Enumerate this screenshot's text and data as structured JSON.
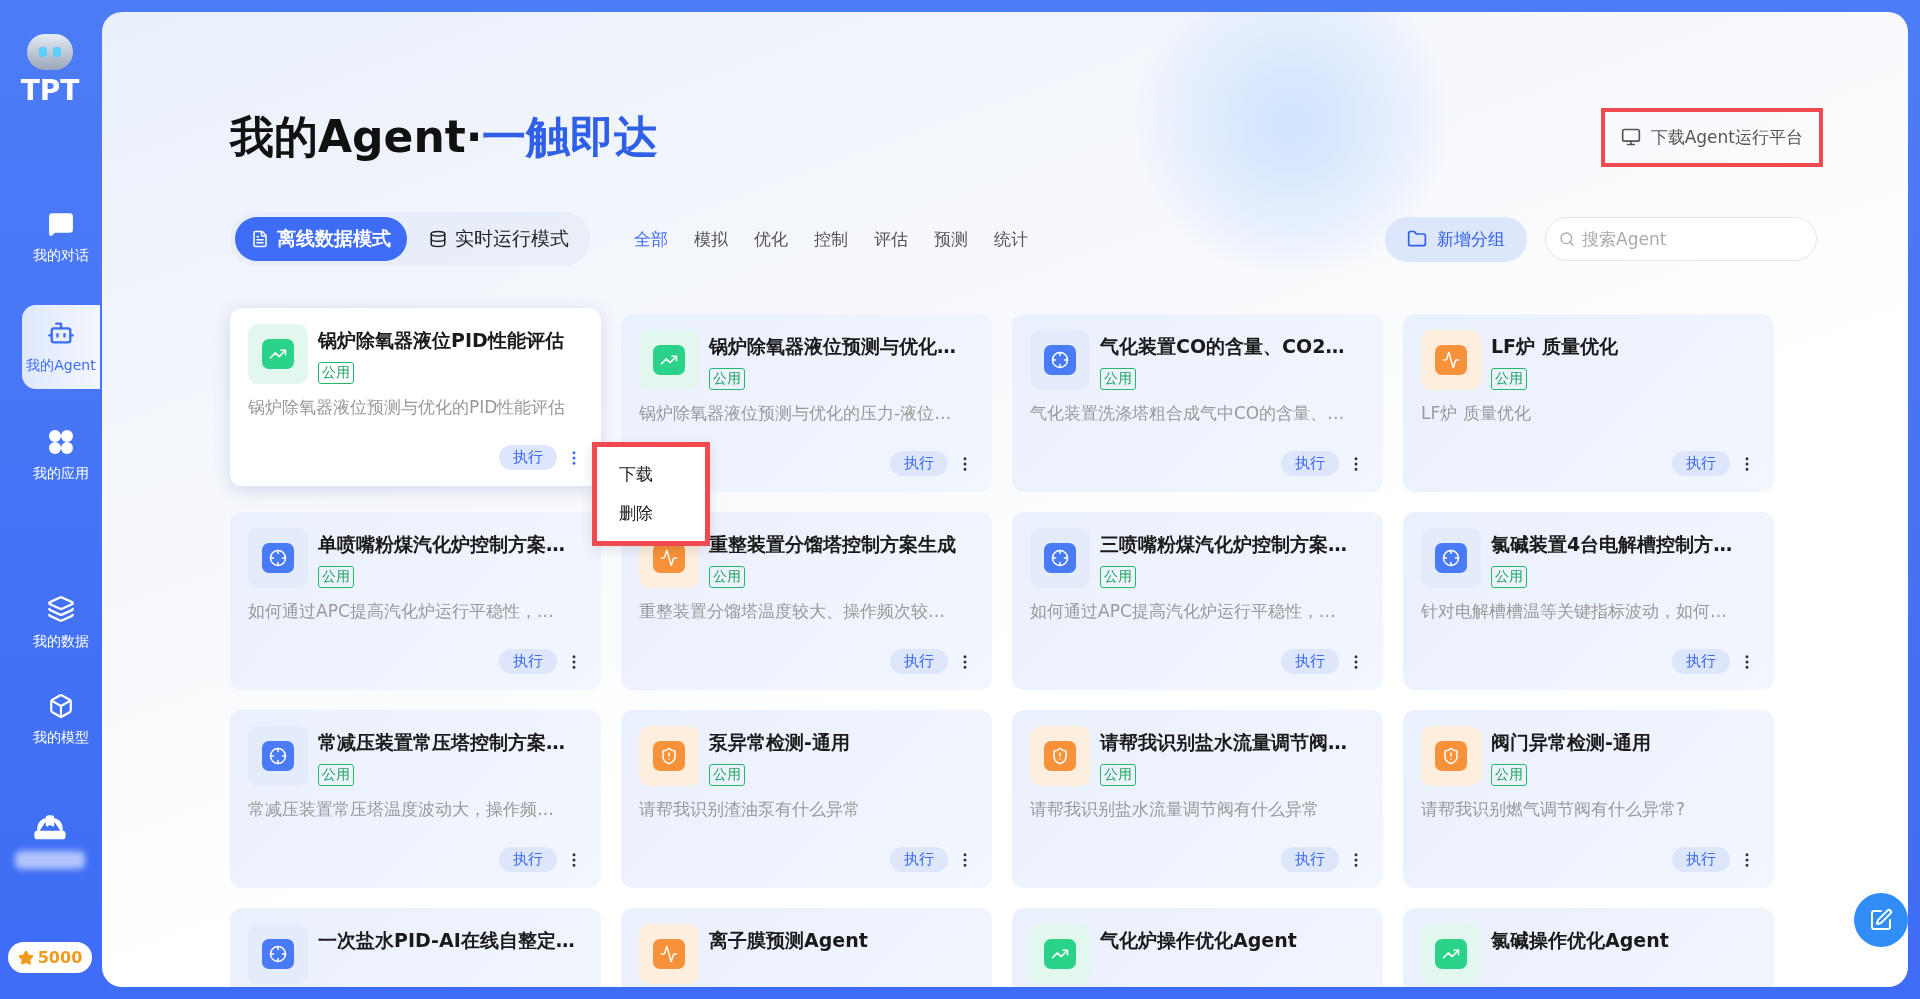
{
  "sidebar": {
    "logo": "TPT",
    "items": [
      {
        "kind": "chat",
        "label": "我的对话",
        "selected": false
      },
      {
        "kind": "agent",
        "label": "我的Agent",
        "selected": true
      },
      {
        "kind": "apps",
        "label": "我的应用",
        "selected": false
      },
      {
        "kind": "data",
        "label": "我的数据",
        "selected": false
      },
      {
        "kind": "model",
        "label": "我的模型",
        "selected": false
      }
    ],
    "coins": "5000"
  },
  "header": {
    "title": "我的Agent·",
    "title_accent": "一触即达",
    "download_button": "下载Agent运行平台"
  },
  "modes": [
    {
      "label": "离线数据模式",
      "kind": "file",
      "selected": true
    },
    {
      "label": "实时运行模式",
      "kind": "db",
      "selected": false
    }
  ],
  "filters": [
    {
      "label": "全部",
      "selected": true
    },
    {
      "label": "模拟",
      "selected": false
    },
    {
      "label": "优化",
      "selected": false
    },
    {
      "label": "控制",
      "selected": false
    },
    {
      "label": "评估",
      "selected": false
    },
    {
      "label": "预测",
      "selected": false
    },
    {
      "label": "统计",
      "selected": false
    }
  ],
  "new_group_button": "新增分组",
  "search": {
    "placeholder": "搜索Agent"
  },
  "cards": [
    {
      "kind": "trend",
      "title": "锅炉除氧器液位PID性能评估",
      "badge": "公用",
      "description": "锅炉除氧器液位预测与优化的PID性能评估",
      "run": "执行",
      "highlighted": true
    },
    {
      "kind": "trend",
      "title": "锅炉除氧器液位预测与优化…",
      "badge": "公用",
      "description": "锅炉除氧器液位预测与优化的压力-液位…",
      "run": "执行",
      "highlighted": false
    },
    {
      "kind": "target",
      "title": "气化装置CO的含量、CO2…",
      "badge": "公用",
      "description": "气化装置洗涤塔粗合成气中CO的含量、…",
      "run": "执行",
      "highlighted": false
    },
    {
      "kind": "pulse",
      "title": "LF炉 质量优化",
      "badge": "公用",
      "description": "LF炉 质量优化",
      "run": "执行",
      "highlighted": false
    },
    {
      "kind": "target",
      "title": "单喷嘴粉煤汽化炉控制方案…",
      "badge": "公用",
      "description": "如何通过APC提高汽化炉运行平稳性，…",
      "run": "执行",
      "highlighted": false
    },
    {
      "kind": "pulse",
      "title": "重整装置分馏塔控制方案生成",
      "badge": "公用",
      "description": "重整装置分馏塔温度较大、操作频次较…",
      "run": "执行",
      "highlighted": false
    },
    {
      "kind": "target",
      "title": "三喷嘴粉煤汽化炉控制方案…",
      "badge": "公用",
      "description": "如何通过APC提高汽化炉运行平稳性，…",
      "run": "执行",
      "highlighted": false
    },
    {
      "kind": "target",
      "title": "氯碱装置4台电解槽控制方…",
      "badge": "公用",
      "description": "针对电解槽槽温等关键指标波动，如何…",
      "run": "执行",
      "highlighted": false
    },
    {
      "kind": "target",
      "title": "常减压装置常压塔控制方案…",
      "badge": "公用",
      "description": "常减压装置常压塔温度波动大，操作频…",
      "run": "执行",
      "highlighted": false
    },
    {
      "kind": "shield",
      "title": "泵异常检测-通用",
      "badge": "公用",
      "description": "请帮我识别渣油泵有什么异常",
      "run": "执行",
      "highlighted": false
    },
    {
      "kind": "shield",
      "title": "请帮我识别盐水流量调节阀…",
      "badge": "公用",
      "description": "请帮我识别盐水流量调节阀有什么异常",
      "run": "执行",
      "highlighted": false
    },
    {
      "kind": "shield",
      "title": "阀门异常检测-通用",
      "badge": "公用",
      "description": "请帮我识别燃气调节阀有什么异常?",
      "run": "执行",
      "highlighted": false
    },
    {
      "kind": "target",
      "title": "一次盐水PID-AI在线自整定…"
    },
    {
      "kind": "pulse",
      "title": "离子膜预测Agent"
    },
    {
      "kind": "trend",
      "title": "气化炉操作优化Agent"
    },
    {
      "kind": "trend",
      "title": "氯碱操作优化Agent"
    }
  ],
  "context_menu": {
    "items": [
      "下载",
      "删除"
    ]
  }
}
